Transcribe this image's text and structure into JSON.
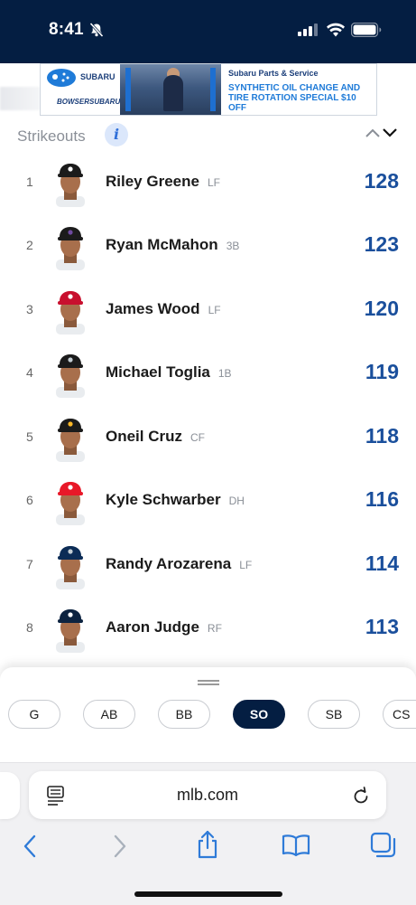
{
  "status_bar": {
    "time": "8:41"
  },
  "ad": {
    "brand_top": "SUBARU",
    "brand_bottom": "BOWSERSUBARU",
    "title": "Subaru Parts & Service",
    "offer": "SYNTHETIC OIL CHANGE AND TIRE ROTATION SPECIAL $10 OFF"
  },
  "leaders": {
    "stat_label": "Strikeouts",
    "info_icon": "i",
    "rows": [
      {
        "rank": "1",
        "name": "Riley Greene",
        "pos": "LF",
        "value": "128",
        "cap": "#1b1b1b",
        "logo": "#ffffff"
      },
      {
        "rank": "2",
        "name": "Ryan McMahon",
        "pos": "3B",
        "value": "123",
        "cap": "#1b1b1b",
        "logo": "#6e4aa0"
      },
      {
        "rank": "3",
        "name": "James Wood",
        "pos": "LF",
        "value": "120",
        "cap": "#c8102e",
        "logo": "#ffffff"
      },
      {
        "rank": "4",
        "name": "Michael Toglia",
        "pos": "1B",
        "value": "119",
        "cap": "#1b1b1b",
        "logo": "#c4ced4"
      },
      {
        "rank": "5",
        "name": "Oneil Cruz",
        "pos": "CF",
        "value": "118",
        "cap": "#1b1b1b",
        "logo": "#fdb827"
      },
      {
        "rank": "6",
        "name": "Kyle Schwarber",
        "pos": "DH",
        "value": "116",
        "cap": "#e81828",
        "logo": "#ffffff"
      },
      {
        "rank": "7",
        "name": "Randy Arozarena",
        "pos": "LF",
        "value": "114",
        "cap": "#0c2c56",
        "logo": "#c4ced4"
      },
      {
        "rank": "8",
        "name": "Aaron Judge",
        "pos": "RF",
        "value": "113",
        "cap": "#0c2340",
        "logo": "#ffffff"
      }
    ]
  },
  "stat_tabs": {
    "items": [
      "G",
      "AB",
      "BB",
      "SO",
      "SB",
      "CS"
    ],
    "active": "SO"
  },
  "browser": {
    "url": "mlb.com"
  },
  "colors": {
    "navy": "#041e42",
    "value_blue": "#1a4f9c",
    "link_blue": "#2f7bd8"
  }
}
